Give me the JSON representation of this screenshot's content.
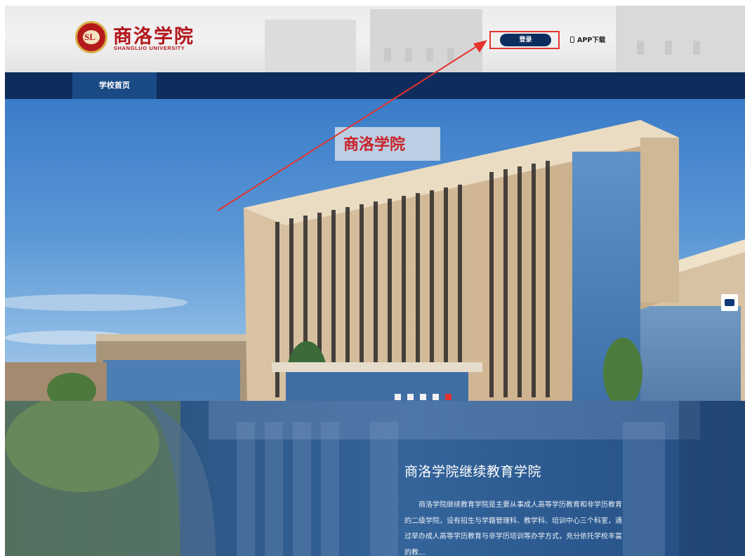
{
  "header": {
    "logo_emblem": "SL",
    "logo_name_cn": "商洛学院",
    "logo_name_en": "SHANGLUO UNIVERSITY",
    "login_label": "登录",
    "app_download_label": "APP下载"
  },
  "nav": {
    "items": [
      {
        "label": "学校首页",
        "active": true
      }
    ]
  },
  "banner": {
    "sign_text": "商洛学院",
    "slide_count": 5,
    "active_slide": 5,
    "icons": [
      "phone-icon",
      "briefcase-icon"
    ]
  },
  "intro": {
    "title": "商洛学院继续教育学院",
    "text": "商洛学院继续教育学院是主要从事成人高等学历教育和非学历教育的二级学院，设有招生与学籍管理科、教学科、培训中心三个科室，通过举办成人高等学历教育与非学历培训等办学方式，充分依托学校丰富的教..."
  },
  "colors": {
    "nav_bg": "#0e2c5c",
    "nav_active": "#1a4a86",
    "brand_red": "#b3161b",
    "highlight_red": "#e4342c",
    "login_btn": "#0c2e5e"
  }
}
